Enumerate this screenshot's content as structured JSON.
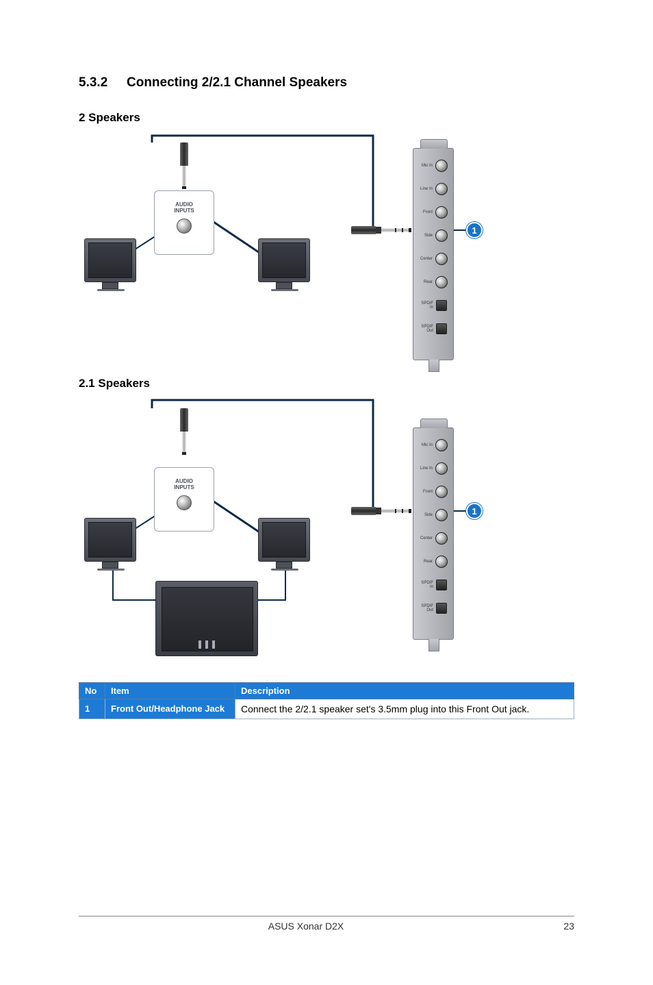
{
  "section": {
    "number": "5.3.2",
    "title": "Connecting 2/2.1 Channel Speakers"
  },
  "diagram1_title": "2 Speakers",
  "diagram2_title": "2.1 Speakers",
  "audiobox_label": "AUDIO\nINPUTS",
  "bracket_jacks": [
    "Mic In",
    "Line In",
    "Front",
    "Side",
    "Center",
    "Rear",
    "SPDIF In",
    "SPDIF Out"
  ],
  "marker_1": "1",
  "table": {
    "headers": {
      "no": "No",
      "item": "Item",
      "desc": "Description"
    },
    "rows": [
      {
        "no": "1",
        "item": "Front Out/Headphone Jack",
        "desc": "Connect the 2/2.1 speaker set's 3.5mm plug into this Front Out jack."
      }
    ]
  },
  "footer": {
    "product": "ASUS Xonar D2X",
    "page": "23"
  }
}
